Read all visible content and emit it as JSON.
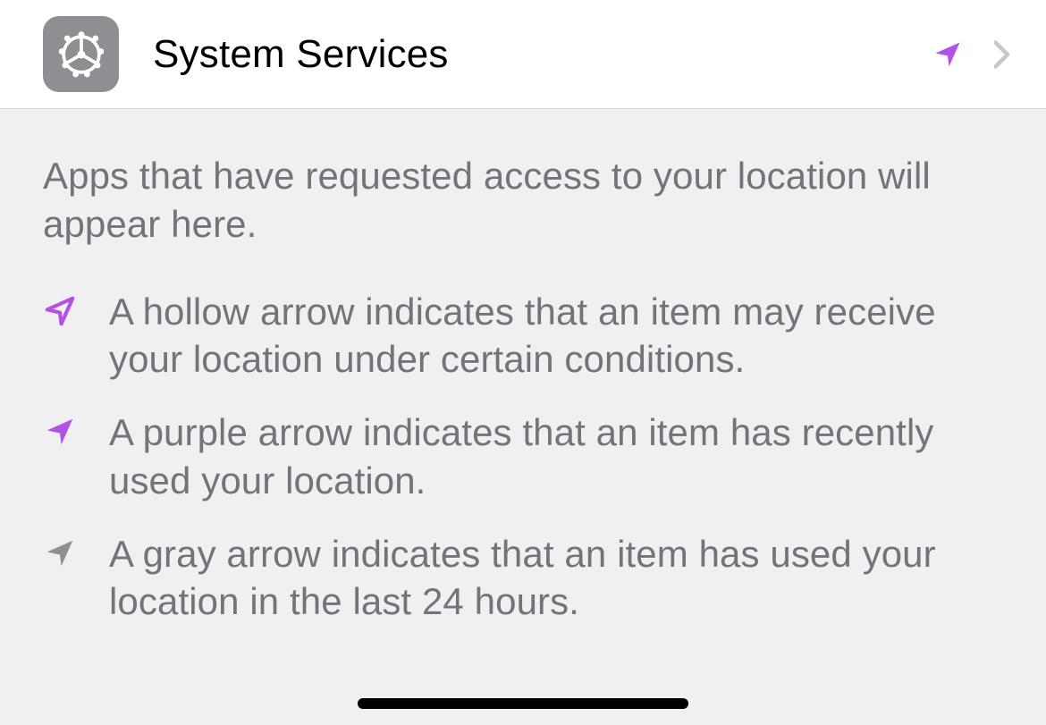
{
  "colors": {
    "purple": "#b251e6",
    "gray": "#8e8e93",
    "chevron": "#c7c7cc"
  },
  "row": {
    "title": "System Services"
  },
  "footer": {
    "intro": "Apps that have requested access to your location will appear here.",
    "legend": [
      {
        "text": "A hollow arrow indicates that an item may receive your location under certain conditions."
      },
      {
        "text": "A purple arrow indicates that an item has recently used your location."
      },
      {
        "text": "A gray arrow indicates that an item has used your location in the last 24 hours."
      }
    ]
  }
}
